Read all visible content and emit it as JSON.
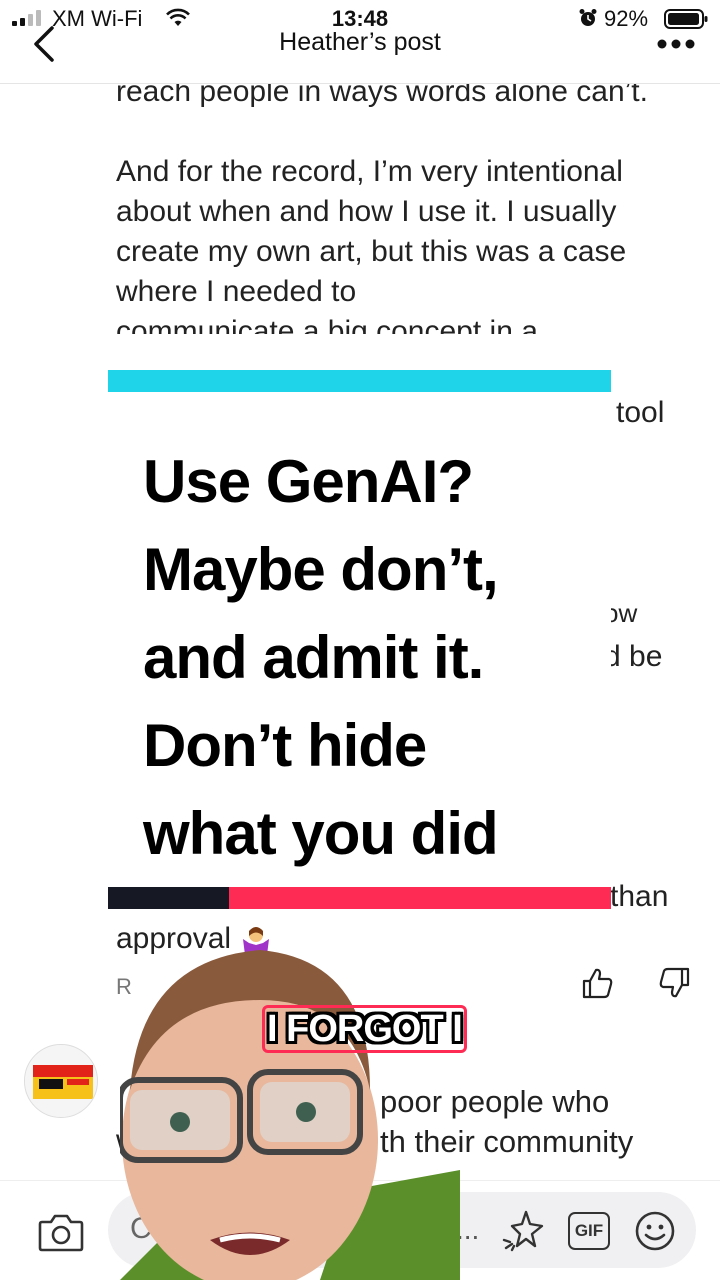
{
  "status_bar": {
    "carrier": "XM Wi-Fi",
    "time": "13:48",
    "battery_percent": "92%"
  },
  "nav": {
    "title": "Heather’s post"
  },
  "post": {
    "paragraph1_tail": "reach people in ways words alone can’t.",
    "paragraph2": "And for the record, I’m very intentional about when and how I use it. I usually create my own art, but this was a case where I needed to",
    "paragraph2_cut": "communicate a big concept in a",
    "frag_tool": "tool",
    "frag_ow": "ow",
    "frag_be": "d be",
    "frag_than": "than",
    "approval": "approval"
  },
  "overlay": {
    "caption_lines": [
      "Use GenAI?",
      "Maybe don’t,",
      "and admit it.",
      "Don’t hide",
      "what you did"
    ],
    "subtitle": "I FORGOT I",
    "colors": {
      "cyan": "#1fd3e9",
      "red": "#fe2c55",
      "dark": "#161823"
    }
  },
  "reply": {
    "label": "R"
  },
  "comment": {
    "line1": "poor people who",
    "line2": "th their community",
    "cut_w": "w"
  },
  "toolbar": {
    "input_placeholder": "C",
    "ellipsis": "...",
    "gif_label": "GIF"
  }
}
